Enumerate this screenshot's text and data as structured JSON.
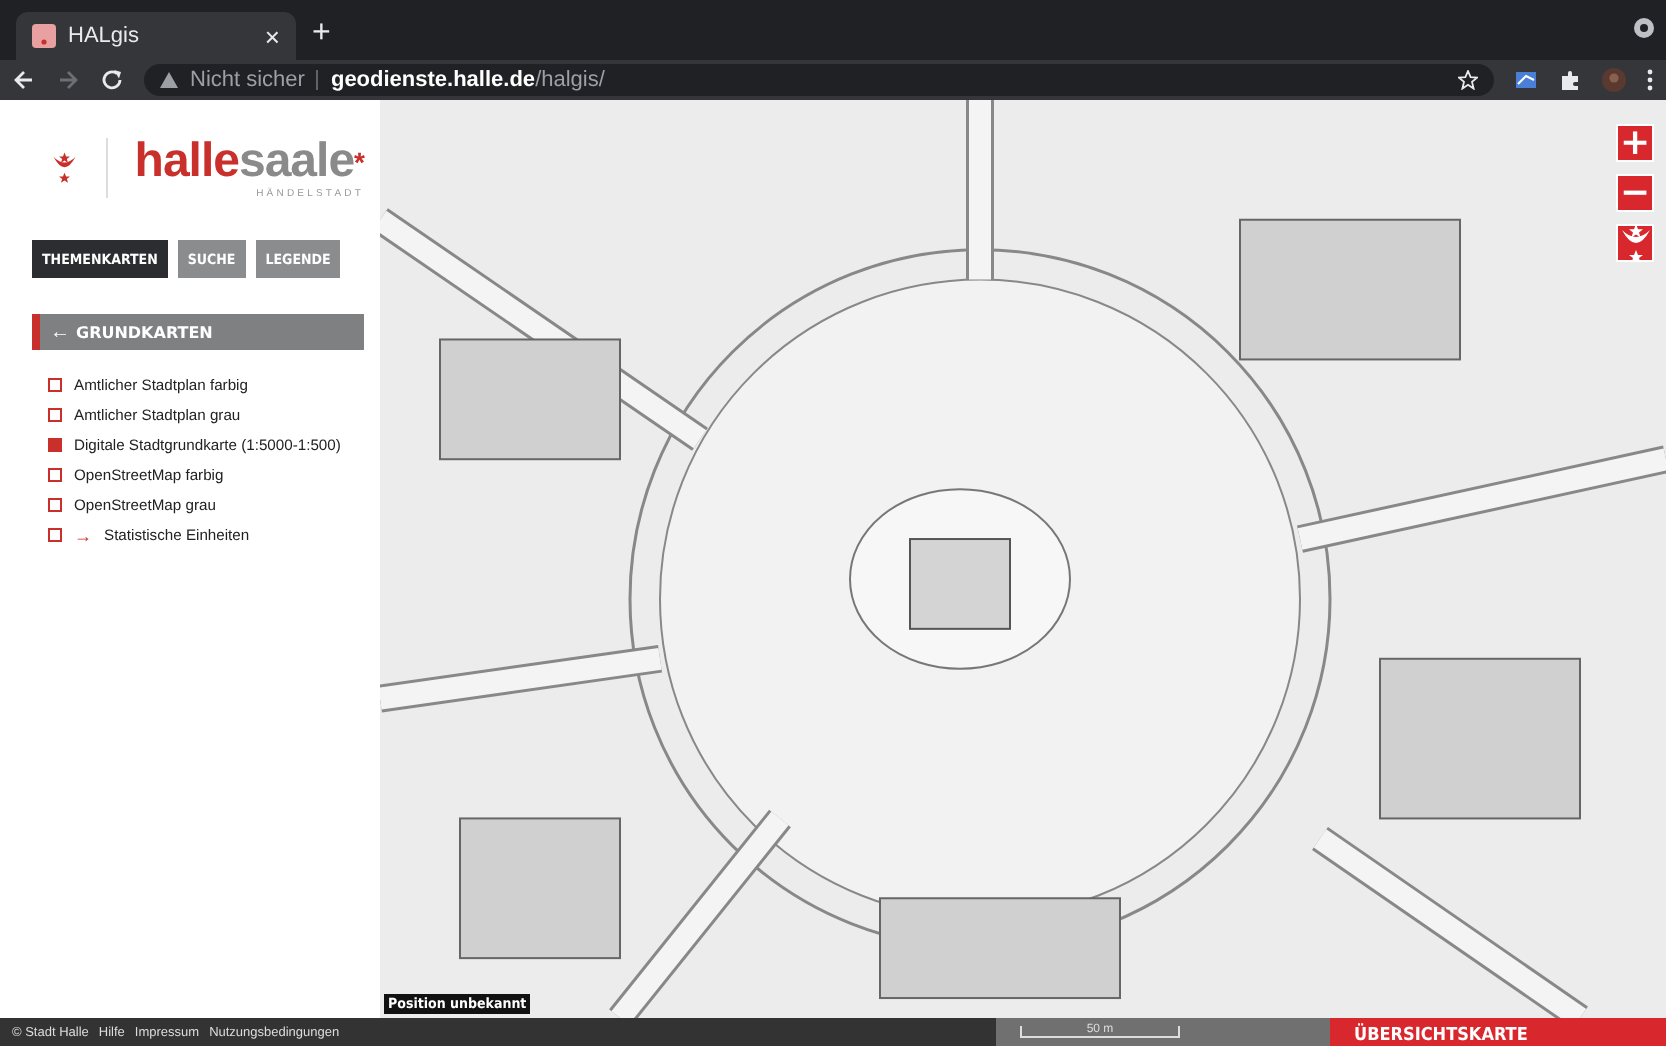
{
  "browser": {
    "tab_title": "HALgis",
    "tab_close": "×",
    "new_tab": "+",
    "security": "Nicht sicher",
    "url_host": "geodienste.halle.de",
    "url_path": "/halgis/"
  },
  "logo": {
    "part_1": "halle",
    "part_2": "saale",
    "mark": "*",
    "tagline": "HÄNDELSTADT"
  },
  "tabs": [
    {
      "label": "THEMENKARTEN",
      "selected": true
    },
    {
      "label": "SUCHE",
      "selected": false
    },
    {
      "label": "LEGENDE",
      "selected": false
    }
  ],
  "section": {
    "back": "←",
    "title": "GRUNDKARTEN"
  },
  "layers": [
    {
      "kind": "layer",
      "label": "Amtlicher Stadtplan farbig",
      "selected": false
    },
    {
      "kind": "layer",
      "label": "Amtlicher Stadtplan grau",
      "selected": false
    },
    {
      "kind": "layer",
      "label": "Digitale Stadtgrundkarte (1:5000-1:500)",
      "selected": true
    },
    {
      "kind": "layer",
      "label": "OpenStreetMap farbig",
      "selected": false
    },
    {
      "kind": "layer",
      "label": "OpenStreetMap grau",
      "selected": false
    },
    {
      "kind": "group",
      "arrow": "→",
      "label": "Statistische Einheiten",
      "selected": false
    }
  ],
  "map_controls": [
    {
      "kind": "text",
      "label": "+"
    },
    {
      "kind": "text",
      "label": "−"
    },
    {
      "kind": "emblem"
    }
  ],
  "position": "Position unbekannt",
  "footer": {
    "links": [
      "© Stadt Halle",
      "Hilfe",
      "Impressum",
      "Nutzungsbedingungen"
    ],
    "scale": "50 m",
    "overview": "ÜBERSICHTSKARTE"
  }
}
